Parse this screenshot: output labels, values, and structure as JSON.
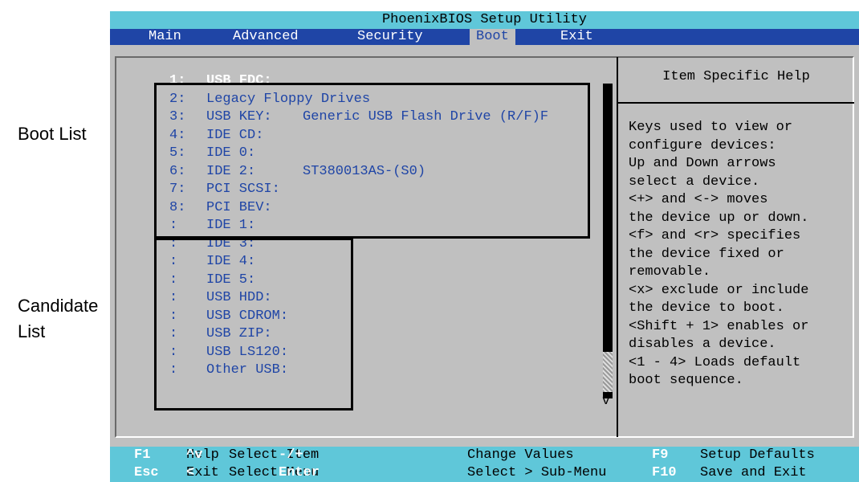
{
  "annotations": {
    "boot_list": "Boot List",
    "candidate_list_line1": "Candidate",
    "candidate_list_line2": "List"
  },
  "bios": {
    "title": "PhoenixBIOS Setup Utility",
    "menu": [
      "Main",
      "Advanced",
      "Security",
      "Boot",
      "Exit"
    ],
    "active_menu": "Boot"
  },
  "boot_list": [
    {
      "num": "1:",
      "label": "USB FDC:",
      "device": "",
      "selected": true
    },
    {
      "num": "2:",
      "label": "Legacy Floppy Drives",
      "device": ""
    },
    {
      "num": "3:",
      "label": "USB KEY:",
      "device": "Generic USB Flash Drive (R/F)F"
    },
    {
      "num": "4:",
      "label": "IDE CD:",
      "device": ""
    },
    {
      "num": "5:",
      "label": "IDE 0:",
      "device": ""
    },
    {
      "num": "6:",
      "label": "IDE 2:",
      "device": "ST380013AS-(S0)"
    },
    {
      "num": "7:",
      "label": "PCI SCSI:",
      "device": ""
    },
    {
      "num": "8:",
      "label": "PCI BEV:",
      "device": ""
    }
  ],
  "candidate_list": [
    {
      "num": ":",
      "label": "IDE 1:"
    },
    {
      "num": ":",
      "label": "IDE 3:"
    },
    {
      "num": ":",
      "label": "IDE 4:"
    },
    {
      "num": ":",
      "label": "IDE 5:"
    },
    {
      "num": ":",
      "label": "USB HDD:"
    },
    {
      "num": ":",
      "label": "USB CDROM:"
    },
    {
      "num": ":",
      "label": "USB ZIP:"
    },
    {
      "num": ":",
      "label": "USB LS120:"
    },
    {
      "num": ":",
      "label": "Other USB:"
    }
  ],
  "scroll_arrow": "v",
  "help": {
    "title": "Item Specific Help",
    "lines": [
      "Keys used to view or",
      "configure devices:",
      "Up and Down arrows",
      "select a device.",
      "<+> and <-> moves",
      "the device up or down.",
      "<f> and <r> specifies",
      "the device fixed or",
      "removable.",
      "<x> exclude or include",
      "the device to boot.",
      "<Shift + 1> enables or",
      "disables a device.",
      "<1 - 4> Loads default",
      "boot sequence."
    ]
  },
  "status_bar": {
    "row1": [
      {
        "key": "F1",
        "desc": "Help"
      },
      {
        "key": "^v",
        "desc": "Select Item"
      },
      {
        "key": "-/+",
        "desc": "Change Values"
      },
      {
        "key": "F9",
        "desc": "Setup Defaults"
      }
    ],
    "row2": [
      {
        "key": "Esc",
        "desc": "Exit"
      },
      {
        "key": "<",
        "desc": "Select Menu"
      },
      {
        "key": "Enter",
        "desc": "Select > Sub-Menu"
      },
      {
        "key": "F10",
        "desc": "Save and Exit"
      }
    ]
  },
  "colors": {
    "bios_blue": "#1f45a6",
    "bar_cyan": "#5fc7d9",
    "panel_gray": "#c0c0c0"
  }
}
